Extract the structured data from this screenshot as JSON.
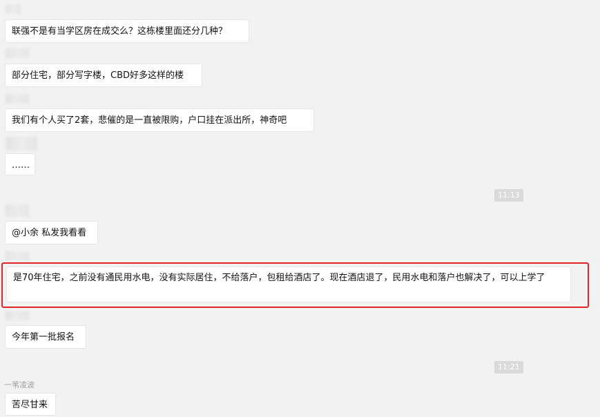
{
  "messages": [
    {
      "text": "联强不是有当学区房在成交么？这栋楼里面还分几种？"
    },
    {
      "text": "部分住宅，部分写字楼，CBD好多这样的楼"
    },
    {
      "text": "我们有个人买了2套，悲催的是一直被限购，户口挂在派出所，神奇吧"
    },
    {
      "text": "……"
    },
    {
      "text": "@小余 私发我看看"
    },
    {
      "text": "是70年住宅，之前没有通民用水电，没有实际居住，不给落户，包租给酒店了。现在酒店退了，民用水电和落户也解决了，可以上学了"
    },
    {
      "text": "今年第一批报名"
    },
    {
      "text": "苦尽甘来",
      "sender": "一苇凌波"
    }
  ],
  "timestamps": [
    "11:13",
    "11:21"
  ],
  "colors": {
    "background": "#f2f2f2",
    "bubble": "#ffffff",
    "highlight_border": "#e02424",
    "timestamp_bg": "#dadada"
  }
}
